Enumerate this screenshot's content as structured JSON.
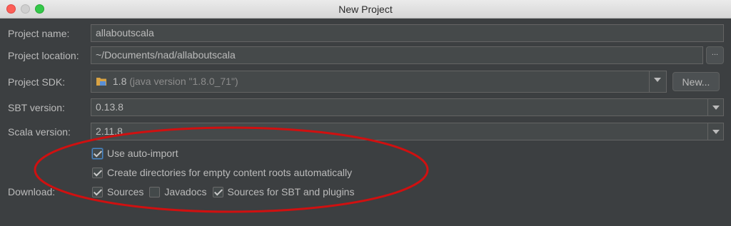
{
  "window": {
    "title": "New Project"
  },
  "form": {
    "project_name_label": "Project name:",
    "project_name_value": "allaboutscala",
    "project_location_label": "Project location:",
    "project_location_value": "~/Documents/nad/allaboutscala",
    "browse_label": "...",
    "project_sdk_label": "Project SDK:",
    "project_sdk_version": "1.8",
    "project_sdk_detail": "(java version \"1.8.0_71\")",
    "new_button_label": "New...",
    "sbt_version_label": "SBT version:",
    "sbt_version_value": "0.13.8",
    "scala_version_label": "Scala version:",
    "scala_version_value": "2.11.8"
  },
  "options": {
    "auto_import": {
      "label": "Use auto-import",
      "checked": true
    },
    "create_dirs": {
      "label": "Create directories for empty content roots automatically",
      "checked": true
    }
  },
  "download": {
    "label": "Download:",
    "sources": {
      "label": "Sources",
      "checked": true
    },
    "javadocs": {
      "label": "Javadocs",
      "checked": false
    },
    "sbt_sources": {
      "label": "Sources for SBT and plugins",
      "checked": true
    }
  },
  "colors": {
    "background": "#3c3f41",
    "field_background": "#45494a",
    "annotation_ellipse": "#d01010"
  }
}
